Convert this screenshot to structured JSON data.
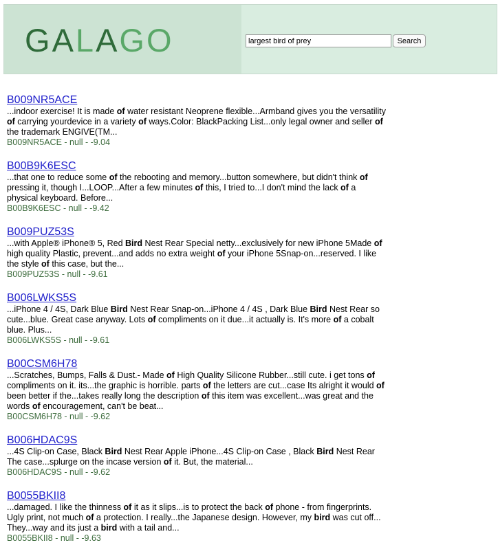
{
  "header": {
    "logo_text": "GALAGO",
    "logo_colors": {
      "dark": "#2f6b3a",
      "light": "#5aa868"
    },
    "background": "#d9ede0",
    "search": {
      "value": "largest bird of prey",
      "button_label": "Search"
    }
  },
  "results": [
    {
      "title": "B009NR5ACE",
      "snippet": [
        {
          "t": "...indoor exercise! It is made "
        },
        {
          "b": "of"
        },
        {
          "t": " water resistant Neoprene flexible...Armband gives you the versatility "
        },
        {
          "b": "of"
        },
        {
          "t": " carrying yourdevice in a variety "
        },
        {
          "b": "of"
        },
        {
          "t": " ways.Color: BlackPacking List...only legal owner and seller "
        },
        {
          "b": "of"
        },
        {
          "t": " the trademark ENGIVE(TM..."
        }
      ],
      "meta": "B009NR5ACE - null - -9.04"
    },
    {
      "title": "B00B9K6ESC",
      "snippet": [
        {
          "t": "...that one to reduce some "
        },
        {
          "b": "of"
        },
        {
          "t": " the rebooting and memory...button somewhere, but didn't think "
        },
        {
          "b": "of"
        },
        {
          "t": " pressing it, though I...LOOP...After a few minutes "
        },
        {
          "b": "of"
        },
        {
          "t": " this, I tried to...I don't mind the lack "
        },
        {
          "b": "of"
        },
        {
          "t": " a physical keyboard. Before..."
        }
      ],
      "meta": "B00B9K6ESC - null - -9.42"
    },
    {
      "title": "B009PUZ53S",
      "snippet": [
        {
          "t": "...with Apple® iPhone® 5, Red "
        },
        {
          "b": "Bird"
        },
        {
          "t": " Nest Rear Special netty...exclusively for new iPhone 5Made "
        },
        {
          "b": "of"
        },
        {
          "t": " high quality Plastic, prevent...and adds no extra weight "
        },
        {
          "b": "of"
        },
        {
          "t": " your iPhone 5Snap-on...reserved. I like the style "
        },
        {
          "b": "of"
        },
        {
          "t": " this case, but the..."
        }
      ],
      "meta": "B009PUZ53S - null - -9.61"
    },
    {
      "title": "B006LWKS5S",
      "snippet": [
        {
          "t": "...iPhone 4 / 4S, Dark Blue "
        },
        {
          "b": "Bird"
        },
        {
          "t": " Nest Rear Snap-on...iPhone 4 / 4S , Dark Blue "
        },
        {
          "b": "Bird"
        },
        {
          "t": " Nest Rear so cute...blue. Great case anyway. Lots "
        },
        {
          "b": "of"
        },
        {
          "t": " compliments on it due...it actually is. It's more "
        },
        {
          "b": "of"
        },
        {
          "t": " a cobalt blue. Plus..."
        }
      ],
      "meta": "B006LWKS5S - null - -9.61"
    },
    {
      "title": "B00CSM6H78",
      "snippet": [
        {
          "t": "...Scratches, Bumps, Falls & Dust.- Made "
        },
        {
          "b": "of"
        },
        {
          "t": " High Quality Silicone Rubber...still cute. i get tons "
        },
        {
          "b": "of"
        },
        {
          "t": " compliments on it. its...the graphic is horrible. parts "
        },
        {
          "b": "of"
        },
        {
          "t": " the letters are cut...case Its alright it would "
        },
        {
          "b": "of"
        },
        {
          "t": " been better if the...takes really long the description "
        },
        {
          "b": "of"
        },
        {
          "t": " this item was excellent...was great and the words "
        },
        {
          "b": "of"
        },
        {
          "t": " encouragement, can't be beat..."
        }
      ],
      "meta": "B00CSM6H78 - null - -9.62"
    },
    {
      "title": "B006HDAC9S",
      "snippet": [
        {
          "t": "...4S Clip-on Case, Black "
        },
        {
          "b": "Bird"
        },
        {
          "t": " Nest Rear Apple iPhone...4S Clip-on Case , Black "
        },
        {
          "b": "Bird"
        },
        {
          "t": " Nest Rear The case...splurge on the incase version "
        },
        {
          "b": "of"
        },
        {
          "t": " it. But, the material..."
        }
      ],
      "meta": "B006HDAC9S - null - -9.62"
    },
    {
      "title": "B0055BKII8",
      "snippet": [
        {
          "t": "...damaged. I like the thinness "
        },
        {
          "b": "of"
        },
        {
          "t": " it as it slips...is to protect the back "
        },
        {
          "b": "of"
        },
        {
          "t": " phone - from fingerprints. Ugly print, not much "
        },
        {
          "b": "of"
        },
        {
          "t": " a protection. I really...the Japanese design. However, my "
        },
        {
          "b": "bird"
        },
        {
          "t": " was cut off... They...way and its just a "
        },
        {
          "b": "bird"
        },
        {
          "t": " with a tail and..."
        }
      ],
      "meta": "B0055BKII8 - null - -9.63"
    }
  ]
}
